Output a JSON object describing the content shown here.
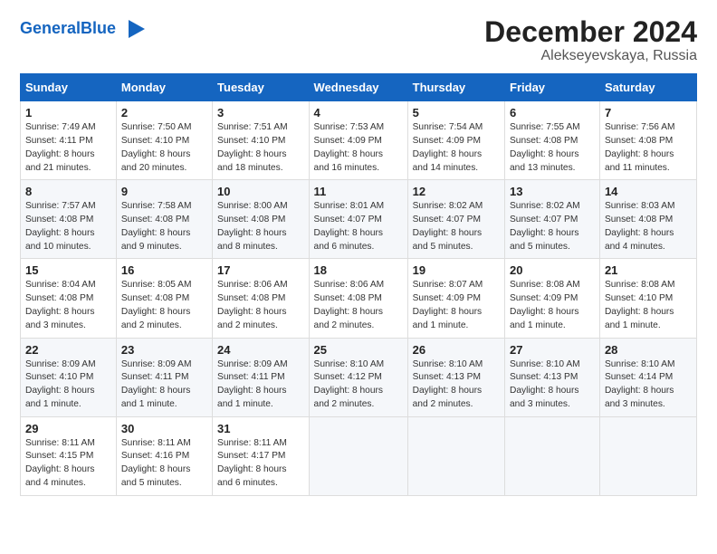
{
  "header": {
    "logo_general": "General",
    "logo_blue": "Blue",
    "title": "December 2024",
    "subtitle": "Alekseyevskaya, Russia"
  },
  "columns": [
    "Sunday",
    "Monday",
    "Tuesday",
    "Wednesday",
    "Thursday",
    "Friday",
    "Saturday"
  ],
  "weeks": [
    [
      {
        "day": "1",
        "info": "Sunrise: 7:49 AM\nSunset: 4:11 PM\nDaylight: 8 hours\nand 21 minutes."
      },
      {
        "day": "2",
        "info": "Sunrise: 7:50 AM\nSunset: 4:10 PM\nDaylight: 8 hours\nand 20 minutes."
      },
      {
        "day": "3",
        "info": "Sunrise: 7:51 AM\nSunset: 4:10 PM\nDaylight: 8 hours\nand 18 minutes."
      },
      {
        "day": "4",
        "info": "Sunrise: 7:53 AM\nSunset: 4:09 PM\nDaylight: 8 hours\nand 16 minutes."
      },
      {
        "day": "5",
        "info": "Sunrise: 7:54 AM\nSunset: 4:09 PM\nDaylight: 8 hours\nand 14 minutes."
      },
      {
        "day": "6",
        "info": "Sunrise: 7:55 AM\nSunset: 4:08 PM\nDaylight: 8 hours\nand 13 minutes."
      },
      {
        "day": "7",
        "info": "Sunrise: 7:56 AM\nSunset: 4:08 PM\nDaylight: 8 hours\nand 11 minutes."
      }
    ],
    [
      {
        "day": "8",
        "info": "Sunrise: 7:57 AM\nSunset: 4:08 PM\nDaylight: 8 hours\nand 10 minutes."
      },
      {
        "day": "9",
        "info": "Sunrise: 7:58 AM\nSunset: 4:08 PM\nDaylight: 8 hours\nand 9 minutes."
      },
      {
        "day": "10",
        "info": "Sunrise: 8:00 AM\nSunset: 4:08 PM\nDaylight: 8 hours\nand 8 minutes."
      },
      {
        "day": "11",
        "info": "Sunrise: 8:01 AM\nSunset: 4:07 PM\nDaylight: 8 hours\nand 6 minutes."
      },
      {
        "day": "12",
        "info": "Sunrise: 8:02 AM\nSunset: 4:07 PM\nDaylight: 8 hours\nand 5 minutes."
      },
      {
        "day": "13",
        "info": "Sunrise: 8:02 AM\nSunset: 4:07 PM\nDaylight: 8 hours\nand 5 minutes."
      },
      {
        "day": "14",
        "info": "Sunrise: 8:03 AM\nSunset: 4:08 PM\nDaylight: 8 hours\nand 4 minutes."
      }
    ],
    [
      {
        "day": "15",
        "info": "Sunrise: 8:04 AM\nSunset: 4:08 PM\nDaylight: 8 hours\nand 3 minutes."
      },
      {
        "day": "16",
        "info": "Sunrise: 8:05 AM\nSunset: 4:08 PM\nDaylight: 8 hours\nand 2 minutes."
      },
      {
        "day": "17",
        "info": "Sunrise: 8:06 AM\nSunset: 4:08 PM\nDaylight: 8 hours\nand 2 minutes."
      },
      {
        "day": "18",
        "info": "Sunrise: 8:06 AM\nSunset: 4:08 PM\nDaylight: 8 hours\nand 2 minutes."
      },
      {
        "day": "19",
        "info": "Sunrise: 8:07 AM\nSunset: 4:09 PM\nDaylight: 8 hours\nand 1 minute."
      },
      {
        "day": "20",
        "info": "Sunrise: 8:08 AM\nSunset: 4:09 PM\nDaylight: 8 hours\nand 1 minute."
      },
      {
        "day": "21",
        "info": "Sunrise: 8:08 AM\nSunset: 4:10 PM\nDaylight: 8 hours\nand 1 minute."
      }
    ],
    [
      {
        "day": "22",
        "info": "Sunrise: 8:09 AM\nSunset: 4:10 PM\nDaylight: 8 hours\nand 1 minute."
      },
      {
        "day": "23",
        "info": "Sunrise: 8:09 AM\nSunset: 4:11 PM\nDaylight: 8 hours\nand 1 minute."
      },
      {
        "day": "24",
        "info": "Sunrise: 8:09 AM\nSunset: 4:11 PM\nDaylight: 8 hours\nand 1 minute."
      },
      {
        "day": "25",
        "info": "Sunrise: 8:10 AM\nSunset: 4:12 PM\nDaylight: 8 hours\nand 2 minutes."
      },
      {
        "day": "26",
        "info": "Sunrise: 8:10 AM\nSunset: 4:13 PM\nDaylight: 8 hours\nand 2 minutes."
      },
      {
        "day": "27",
        "info": "Sunrise: 8:10 AM\nSunset: 4:13 PM\nDaylight: 8 hours\nand 3 minutes."
      },
      {
        "day": "28",
        "info": "Sunrise: 8:10 AM\nSunset: 4:14 PM\nDaylight: 8 hours\nand 3 minutes."
      }
    ],
    [
      {
        "day": "29",
        "info": "Sunrise: 8:11 AM\nSunset: 4:15 PM\nDaylight: 8 hours\nand 4 minutes."
      },
      {
        "day": "30",
        "info": "Sunrise: 8:11 AM\nSunset: 4:16 PM\nDaylight: 8 hours\nand 5 minutes."
      },
      {
        "day": "31",
        "info": "Sunrise: 8:11 AM\nSunset: 4:17 PM\nDaylight: 8 hours\nand 6 minutes."
      },
      null,
      null,
      null,
      null
    ]
  ]
}
